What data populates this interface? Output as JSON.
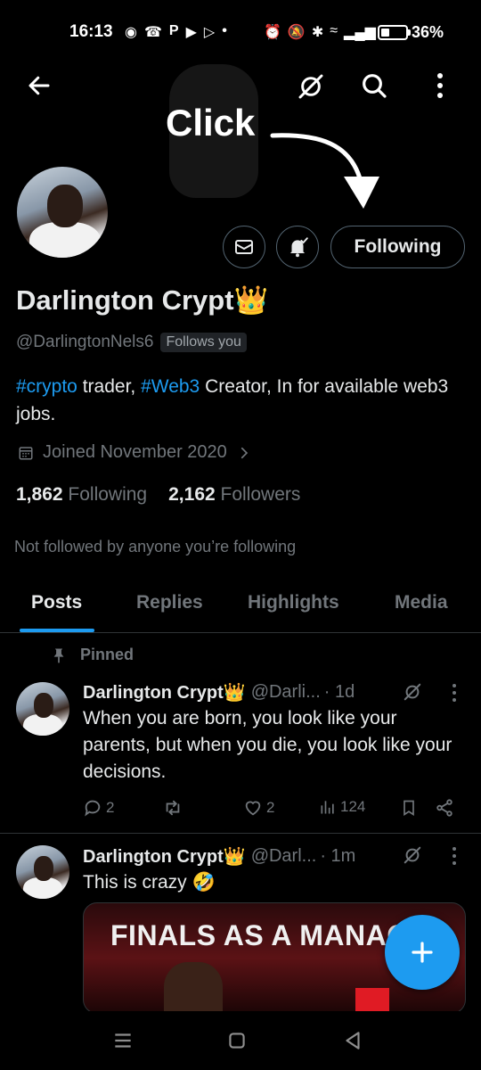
{
  "status_bar": {
    "time": "16:13",
    "left_icons": [
      "game-icon",
      "whatsapp-icon",
      "p-icon",
      "youtube-icon",
      "play-icon",
      "dot-icon"
    ],
    "left_text": "P",
    "right_icons": [
      "alarm-icon",
      "mute-icon",
      "bluetooth-icon",
      "wifi-icon",
      "signal-icon"
    ],
    "battery_percent": "36%",
    "battery_level": 0.36
  },
  "top_bar": {
    "back_icon": "arrow-left-icon",
    "grok_icon": "grok-icon",
    "search_icon": "search-icon",
    "more_icon": "more-vertical-icon"
  },
  "annotation": {
    "click_label": "Click"
  },
  "profile": {
    "name": "Darlington Crypt👑",
    "handle": "@DarlingtonNels6",
    "follows_you": "Follows you",
    "following_button": "Following",
    "bio_parts": [
      "#crypto",
      " trader, ",
      "#Web3",
      " Creator, In for available web3 jobs."
    ],
    "joined": "Joined November 2020",
    "following_count": "1,862",
    "following_label": "Following",
    "followers_count": "2,162",
    "followers_label": "Followers",
    "not_followed": "Not followed by anyone you’re following"
  },
  "tabs": [
    {
      "label": "Posts",
      "active": true
    },
    {
      "label": "Replies",
      "active": false
    },
    {
      "label": "Highlights",
      "active": false
    },
    {
      "label": "Media",
      "active": false
    }
  ],
  "pinned_label": "Pinned",
  "posts": [
    {
      "name": "Darlington Crypt👑",
      "handle": "@Darli...",
      "time": "· 1d",
      "text": "When you are born, you look like your parents, but when you die, you look like your decisions.",
      "replies": "2",
      "reposts": "",
      "likes": "2",
      "views": "124"
    },
    {
      "name": "Darlington Crypt👑",
      "handle": "@Darl...",
      "time": "· 1m",
      "text": "This is crazy 🤣",
      "media_title": "FINALS AS A MANAG"
    }
  ],
  "colors": {
    "accent": "#1d9bf0",
    "background": "#000000",
    "text_primary": "#e7e9ea",
    "text_secondary": "#71767b",
    "border": "#2f3336"
  }
}
